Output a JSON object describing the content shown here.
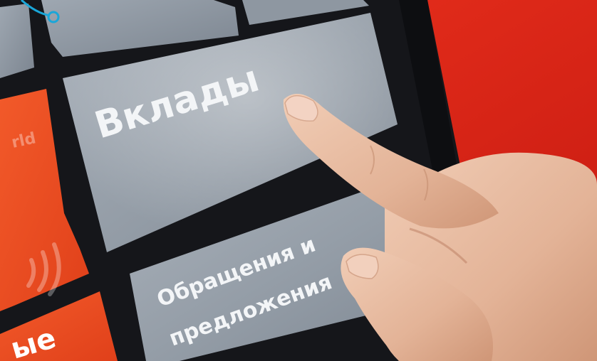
{
  "tiles": {
    "deposits": {
      "label": "Вклады"
    },
    "appeals": {
      "line1": "Обращения и",
      "line2": "предложения"
    },
    "left_tile": {
      "partial_text": "rld"
    },
    "bottom_tile": {
      "partial_text": "ые"
    }
  },
  "icons": {
    "contactless": "contactless-payment-icon",
    "cursor": "cursor-pointer-icon"
  },
  "colors": {
    "kiosk_red": "#e7261b",
    "tile_gray": "#9aa3ad",
    "screen_black": "#15161a",
    "text_white": "#f3f5f7",
    "skin": "#e9bfa6",
    "accent_cyan": "#1aa6d8"
  }
}
